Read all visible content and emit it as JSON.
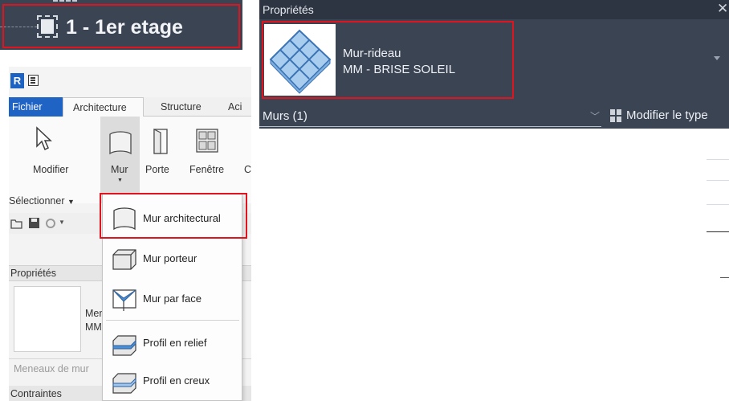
{
  "level_tag": {
    "name": "1 - 1er etage"
  },
  "revit": {
    "app_badge": "R",
    "tabs": [
      {
        "label": "Fichier"
      },
      {
        "label": "Architecture"
      },
      {
        "label": "Structure"
      },
      {
        "label": "Aci"
      }
    ],
    "ribbon": {
      "modify_label": "Modifier",
      "wall_label": "Mur",
      "door_label": "Porte",
      "window_label": "Fenêtre",
      "cut_label": "C",
      "select_label": "Sélectionner"
    },
    "properties": {
      "header": "Propriétés",
      "type_line1": "Men",
      "type_line2": "MM",
      "filter_text": "Meneaux de mur",
      "section": "Contraintes"
    },
    "wall_menu": {
      "items": [
        {
          "label": "Mur architectural",
          "icon": "wall-architectural-icon"
        },
        {
          "label": "Mur porteur",
          "icon": "wall-structural-icon"
        },
        {
          "label": "Mur par face",
          "icon": "wall-by-face-icon"
        },
        {
          "label": "Profil en relief",
          "icon": "wall-sweep-icon"
        },
        {
          "label": "Profil en creux",
          "icon": "wall-reveal-icon"
        }
      ]
    }
  },
  "properties_panel": {
    "title": "Propriétés",
    "close": "✕",
    "type_family": "Mur-rideau",
    "type_name": "MM - BRISE SOLEIL",
    "filter": "Murs (1)",
    "edit_type": "Modifier le type"
  },
  "colors": {
    "highlight": "#e0141e",
    "dark_panel": "#3b4453",
    "revit_blue": "#1f63c5"
  }
}
